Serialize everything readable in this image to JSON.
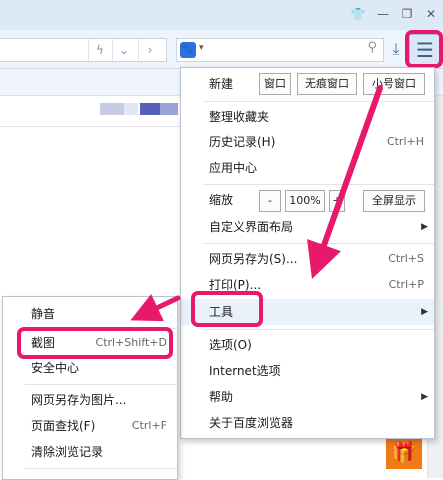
{
  "window": {
    "icons": [
      "shirt-icon",
      "minimize-icon",
      "maximize-icon",
      "close-icon"
    ]
  },
  "address_bar": {
    "icons": [
      "lightning-icon",
      "chevron-down-icon",
      "chevron-right-icon"
    ]
  },
  "search": {
    "engine_icon": "baidu-paw-icon",
    "icons": [
      "search-icon"
    ]
  },
  "toolbar": {
    "icons": [
      "download-icon",
      "menu-icon"
    ]
  },
  "menu": {
    "new_label": "新建",
    "new_window": "窗口",
    "new_incognito": "无痕窗口",
    "new_small": "小号窗口",
    "favorites": "整理收藏夹",
    "history": "历史记录(H)",
    "history_shortcut": "Ctrl+H",
    "app_center": "应用中心",
    "zoom_label": "缩放",
    "zoom_minus": "-",
    "zoom_value": "100%",
    "zoom_plus": "+",
    "fullscreen": "全屏显示",
    "customize": "自定义界面布局",
    "save_as": "网页另存为(S)...",
    "save_as_shortcut": "Ctrl+S",
    "print": "打印(P)...",
    "print_shortcut": "Ctrl+P",
    "tools": "工具",
    "options": "选项(O)",
    "internet_options": "Internet选项",
    "help": "帮助",
    "about": "关于百度浏览器"
  },
  "submenu": {
    "mute": "静音",
    "screenshot": "截图",
    "screenshot_shortcut": "Ctrl+Shift+D",
    "security": "安全中心",
    "save_image": "网页另存为图片...",
    "find": "页面查找(F)",
    "find_shortcut": "Ctrl+F",
    "clear_history": "清除浏览记录"
  },
  "colors": {
    "highlight": "#e8186a",
    "menu_border": "#b9c3cf",
    "gift": "#f07a14"
  }
}
